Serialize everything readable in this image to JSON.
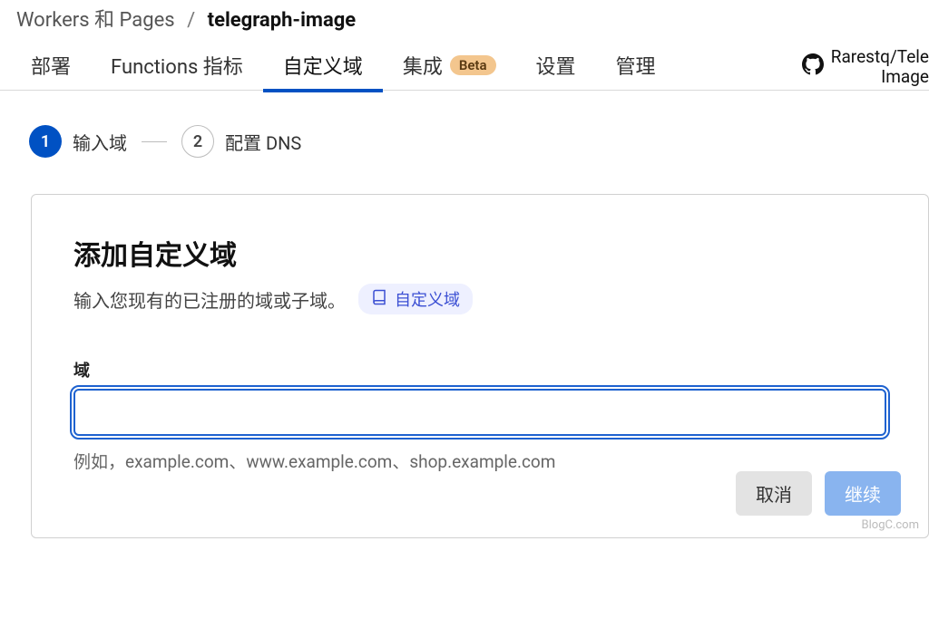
{
  "breadcrumb": {
    "root": "Workers 和 Pages",
    "sep": "/",
    "current": "telegraph-image"
  },
  "tabs": {
    "deploy": "部署",
    "functions": "Functions 指标",
    "custom_domain": "自定义域",
    "integrations": "集成",
    "beta_badge": "Beta",
    "settings": "设置",
    "manage": "管理"
  },
  "repo": {
    "line1": "Rarestq/Tele",
    "line2": "Image"
  },
  "steps": {
    "one": "1",
    "one_label": "输入域",
    "two": "2",
    "two_label": "配置 DNS"
  },
  "card": {
    "title": "添加自定义域",
    "desc": "输入您现有的已注册的域或子域。",
    "doc_link": "自定义域",
    "field_label": "域",
    "input_value": "",
    "hint": "例如，example.com、www.example.com、shop.example.com",
    "cancel": "取消",
    "continue": "继续"
  },
  "watermark": "BlogC.com"
}
